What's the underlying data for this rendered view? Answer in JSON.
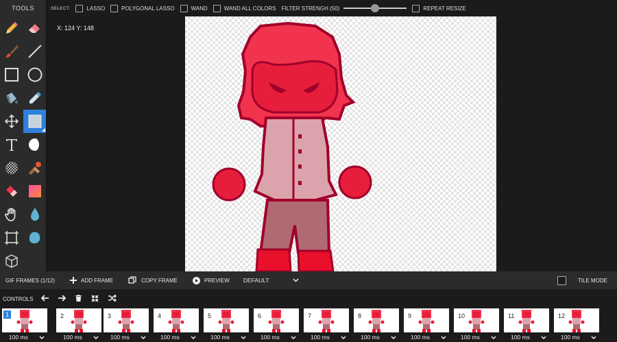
{
  "tools": {
    "title": "TOOLS",
    "items": [
      {
        "name": "pencil-tool",
        "icon": "pencil-icon"
      },
      {
        "name": "eraser-tool",
        "icon": "eraser-icon"
      },
      {
        "name": "brush-tool",
        "icon": "brush-icon"
      },
      {
        "name": "line-tool",
        "icon": "line-icon"
      },
      {
        "name": "rectangle-tool",
        "icon": "rectangle-icon"
      },
      {
        "name": "ellipse-tool",
        "icon": "circle-icon"
      },
      {
        "name": "fill-tool",
        "icon": "bucket-icon"
      },
      {
        "name": "eyedropper-tool",
        "icon": "eyedropper-icon"
      },
      {
        "name": "move-tool",
        "icon": "move-icon"
      },
      {
        "name": "select-tool",
        "icon": "selection-icon",
        "active": true
      },
      {
        "name": "text-tool",
        "icon": "text-icon"
      },
      {
        "name": "lighten-tool",
        "icon": "lighten-icon"
      },
      {
        "name": "dither-tool",
        "icon": "dither-icon"
      },
      {
        "name": "stamp-tool",
        "icon": "stamp-icon"
      },
      {
        "name": "replace-color-tool",
        "icon": "replace-icon"
      },
      {
        "name": "gradient-tool",
        "icon": "gradient-icon"
      },
      {
        "name": "hand-tool",
        "icon": "hand-icon"
      },
      {
        "name": "blur-tool",
        "icon": "drop-icon"
      },
      {
        "name": "crop-tool",
        "icon": "crop-icon"
      },
      {
        "name": "smudge-tool",
        "icon": "blob-icon"
      },
      {
        "name": "3d-tool",
        "icon": "cube-icon"
      }
    ]
  },
  "topbar": {
    "select_label": "SELECT:",
    "lasso": "LASSO",
    "polygonal_lasso": "POLYGONAL LASSO",
    "wand": "WAND",
    "wand_all_colors": "WAND ALL COLORS",
    "filter_strength": "FILTER STRENGH (50)",
    "filter_value": 50,
    "repeat_resize": "REPEAT RESIZE"
  },
  "workspace": {
    "coords": "X: 124 Y: 148"
  },
  "frames_bar": {
    "title": "GIF FRAMES (1/12)",
    "add_frame": "ADD FRAME",
    "copy_frame": "COPY FRAME",
    "preview": "PREVIEW",
    "mode": "DEFAULT",
    "tile_mode": "TILE MODE"
  },
  "controls": {
    "label": "CONTROLS"
  },
  "frames": [
    {
      "num": "1",
      "duration": "100 ms",
      "active": true
    },
    {
      "num": "2",
      "duration": "100 ms"
    },
    {
      "num": "3",
      "duration": "100 ms"
    },
    {
      "num": "4",
      "duration": "100 ms"
    },
    {
      "num": "5",
      "duration": "100 ms"
    },
    {
      "num": "6",
      "duration": "100 ms"
    },
    {
      "num": "7",
      "duration": "100 ms"
    },
    {
      "num": "8",
      "duration": "100 ms"
    },
    {
      "num": "9",
      "duration": "100 ms"
    },
    {
      "num": "10",
      "duration": "100 ms"
    },
    {
      "num": "11",
      "duration": "100 ms"
    },
    {
      "num": "12",
      "duration": "100 ms"
    }
  ],
  "colors": {
    "accent": "#2f7fdc",
    "hair": "#f2334d",
    "outline": "#a0002a",
    "face": "#e61e3c",
    "shirt": "#dba4ac",
    "pants": "#b06b72",
    "boots": "#e8102a"
  }
}
